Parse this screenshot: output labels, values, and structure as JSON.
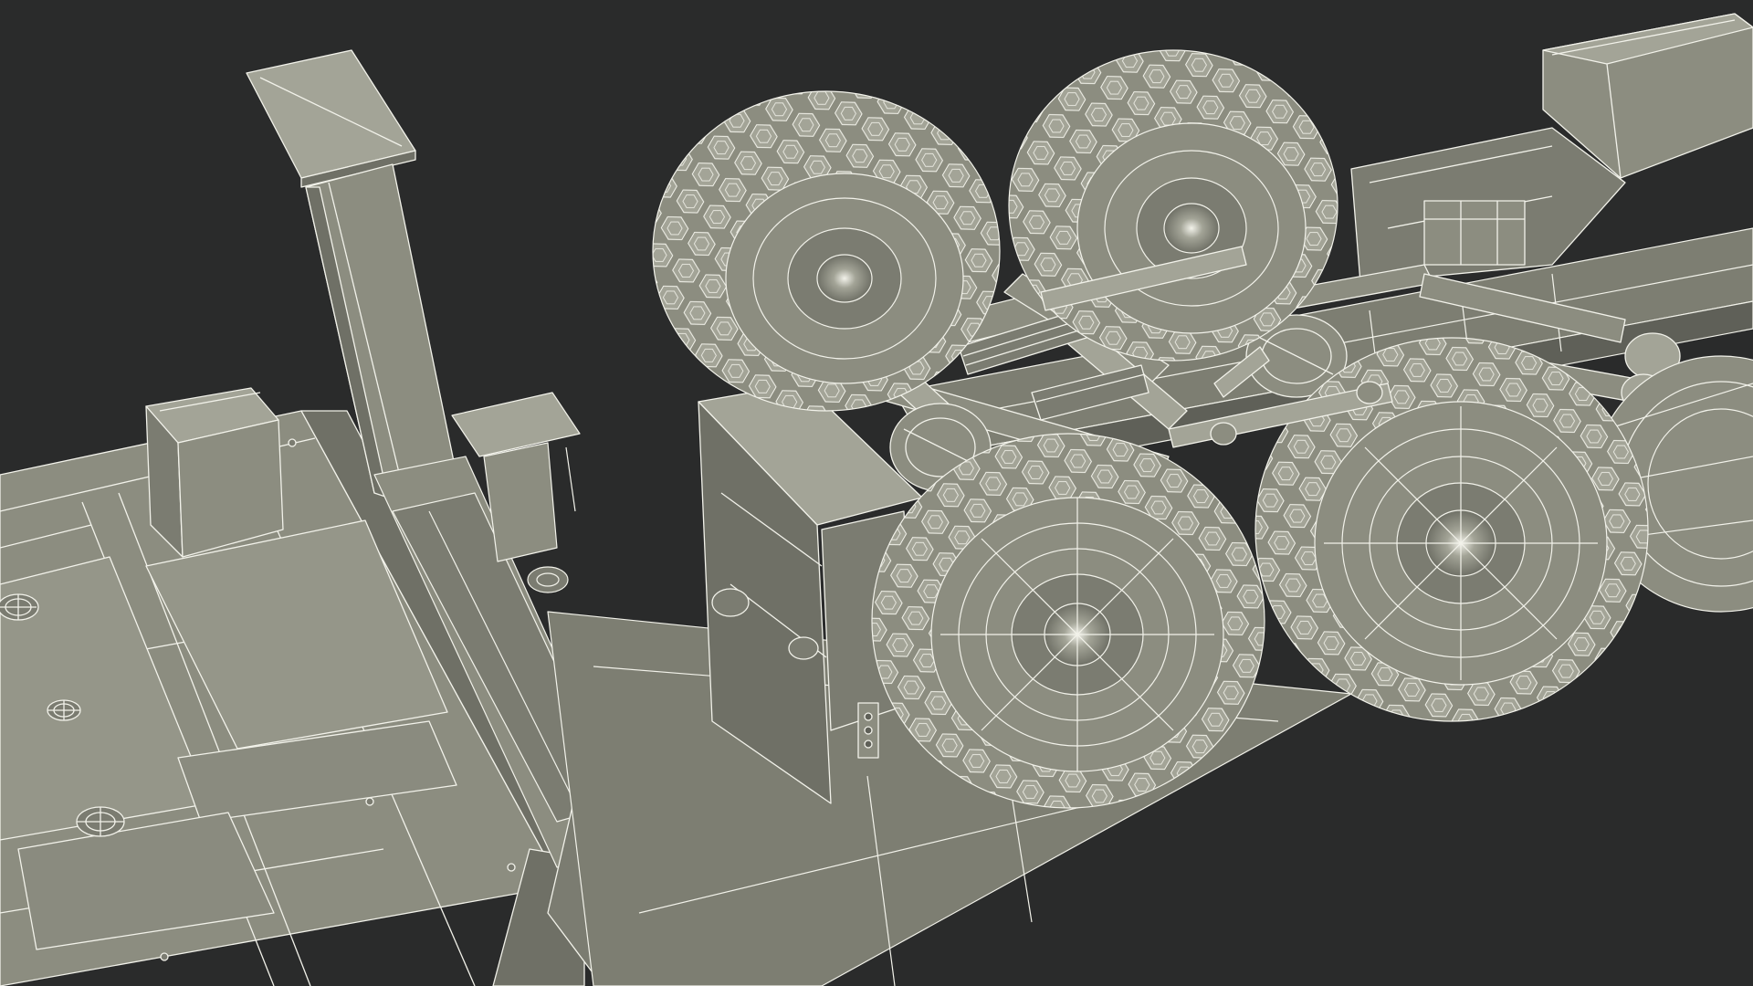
{
  "scene": {
    "colors": {
      "background": "#2a2b2b",
      "surface": "#8c8d80",
      "surface_light": "#a3a497",
      "surface_dark": "#6f7066",
      "wire": "#f2f2ea",
      "shadow": "#1c1d1d"
    },
    "objects": [
      "trailer-deck",
      "exhaust-stack",
      "equipment-box",
      "side-step",
      "front-axle-wheel-left",
      "front-axle-wheel-right",
      "rear-axle-wheel-left",
      "rear-axle-wheel-right",
      "spare-wheel",
      "suspension-assembly",
      "chassis-rail",
      "rear-equipment-box"
    ]
  }
}
